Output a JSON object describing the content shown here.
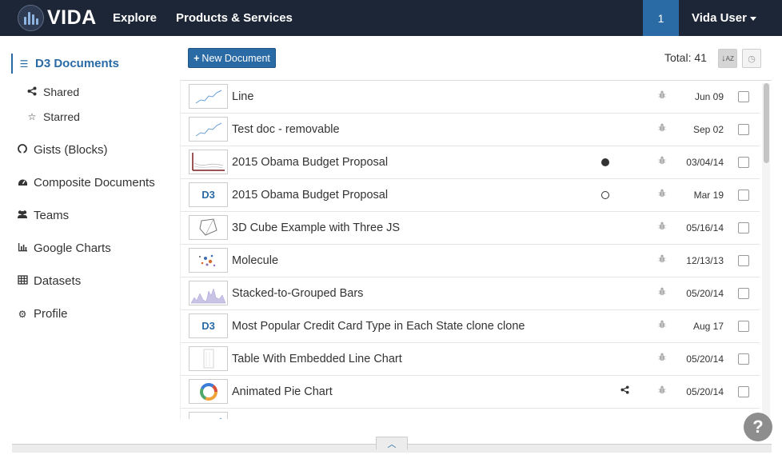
{
  "brand": {
    "name": "VIDA"
  },
  "nav": {
    "explore": "Explore",
    "products": "Products & Services",
    "notifications": "1",
    "user": "Vida User"
  },
  "sidebar": {
    "items": [
      {
        "label": "D3 Documents",
        "icon": "list-icon",
        "active": true
      },
      {
        "label": "Shared",
        "icon": "share-icon",
        "sub": true
      },
      {
        "label": "Starred",
        "icon": "star-outline-icon",
        "sub": true
      },
      {
        "label": "Gists (Blocks)",
        "icon": "github-icon"
      },
      {
        "label": "Composite Documents",
        "icon": "dashboard-icon"
      },
      {
        "label": "Teams",
        "icon": "users-icon"
      },
      {
        "label": "Google Charts",
        "icon": "bar-chart-icon"
      },
      {
        "label": "Datasets",
        "icon": "table-icon"
      },
      {
        "label": "Profile",
        "icon": "gear-icon"
      }
    ]
  },
  "toolbar": {
    "new_document": "New Document",
    "total": "Total: 41"
  },
  "documents": [
    {
      "title": "Line",
      "thumb": "line",
      "date": "Jun 09",
      "marker": "",
      "shared": false
    },
    {
      "title": "Test doc - removable",
      "thumb": "line",
      "date": "Sep 02",
      "marker": "",
      "shared": false
    },
    {
      "title": "2015 Obama Budget Proposal",
      "thumb": "budget",
      "date": "03/04/14",
      "marker": "filled",
      "shared": false
    },
    {
      "title": "2015 Obama Budget Proposal",
      "thumb": "d3",
      "date": "Mar 19",
      "marker": "hollow",
      "shared": false
    },
    {
      "title": "3D Cube Example with Three JS",
      "thumb": "cube",
      "date": "05/16/14",
      "marker": "",
      "shared": false
    },
    {
      "title": "Molecule",
      "thumb": "molecule",
      "date": "12/13/13",
      "marker": "",
      "shared": false
    },
    {
      "title": "Stacked-to-Grouped Bars",
      "thumb": "stacked",
      "date": "05/20/14",
      "marker": "",
      "shared": false
    },
    {
      "title": "Most Popular Credit Card Type in Each State clone clone",
      "thumb": "d3",
      "date": "Aug 17",
      "marker": "",
      "shared": false
    },
    {
      "title": "Table With Embedded Line Chart",
      "thumb": "table",
      "date": "05/20/14",
      "marker": "",
      "shared": false
    },
    {
      "title": "Animated Pie Chart",
      "thumb": "pie",
      "date": "05/20/14",
      "marker": "",
      "shared": true
    }
  ],
  "thumb_d3_text": "D3",
  "help": "?"
}
